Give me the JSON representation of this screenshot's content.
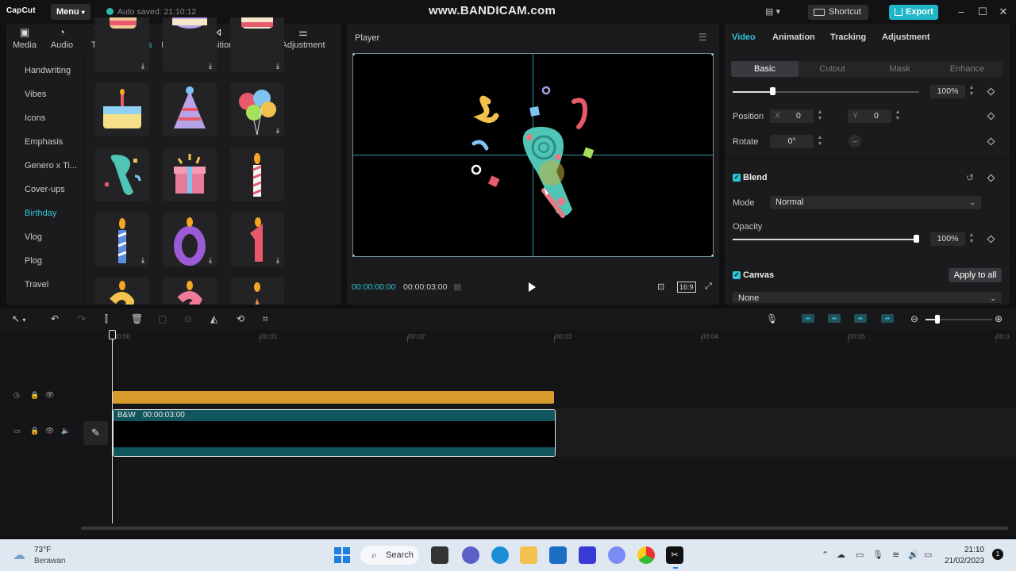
{
  "app": {
    "logo": "CapCut",
    "menu_label": "Menu",
    "autosave": "Auto saved: 21:10:12",
    "watermark": "www.BANDICAM.com",
    "shortcut_label": "Shortcut",
    "export_label": "Export",
    "accent_color": "#2ec3d6"
  },
  "media_tabs": [
    {
      "label": "Media",
      "icon": "media-icon"
    },
    {
      "label": "Audio",
      "icon": "audio-icon"
    },
    {
      "label": "Text",
      "icon": "text-icon"
    },
    {
      "label": "Stickers",
      "icon": "stickers-icon",
      "active": true
    },
    {
      "label": "Effects",
      "icon": "effects-icon"
    },
    {
      "label": "Transitions",
      "icon": "transitions-icon"
    },
    {
      "label": "Filters",
      "icon": "filters-icon"
    },
    {
      "label": "Adjustment",
      "icon": "adjustment-icon"
    }
  ],
  "sticker_categories": [
    {
      "label": "Handwriting"
    },
    {
      "label": "Vibes"
    },
    {
      "label": "Icons"
    },
    {
      "label": "Emphasis"
    },
    {
      "label": "Genero x Ti..."
    },
    {
      "label": "Cover-ups"
    },
    {
      "label": "Birthday",
      "active": true
    },
    {
      "label": "Vlog"
    },
    {
      "label": "Plog"
    },
    {
      "label": "Travel"
    }
  ],
  "stickers": [
    {
      "name": "cake-sticker-top-1",
      "download": true
    },
    {
      "name": "cake-sticker-top-2",
      "download": true
    },
    {
      "name": "cake-sticker-top-3",
      "download": true
    },
    {
      "name": "birthday-cake-sticker",
      "download": false
    },
    {
      "name": "party-hat-sticker",
      "download": false
    },
    {
      "name": "balloons-sticker",
      "download": true
    },
    {
      "name": "party-horn-sticker",
      "download": false
    },
    {
      "name": "gift-box-sticker",
      "download": false
    },
    {
      "name": "candle-sticker",
      "download": false
    },
    {
      "name": "blue-candle-sticker",
      "download": true
    },
    {
      "name": "number-0-candle-sticker",
      "download": true
    },
    {
      "name": "number-1-candle-sticker",
      "download": true
    },
    {
      "name": "number-2-candle-sticker",
      "download": false
    },
    {
      "name": "number-3-candle-sticker",
      "download": false
    },
    {
      "name": "orange-candle-sticker",
      "download": false
    }
  ],
  "player": {
    "label": "Player",
    "current_time": "00:00:00:00",
    "total_time": "00:00:03:00",
    "ratio_label": "16:9"
  },
  "inspector": {
    "tabs": [
      "Video",
      "Animation",
      "Tracking",
      "Adjustment"
    ],
    "subtabs": [
      "Basic",
      "Cutout",
      "Mask",
      "Enhance"
    ],
    "scale_value": "100%",
    "scale_fraction": 1.0,
    "position_label": "Position",
    "pos_x_label": "X",
    "pos_x": "0",
    "pos_y_label": "Y",
    "pos_y": "0",
    "rotate_label": "Rotate",
    "rotate_value": "0°",
    "blend_label": "Blend",
    "mode_label": "Mode",
    "mode_value": "Normal",
    "opacity_label": "Opacity",
    "opacity_value": "100%",
    "opacity_fraction": 1.0,
    "canvas_label": "Canvas",
    "apply_all_label": "Apply to all",
    "canvas_value": "None"
  },
  "timeline": {
    "ruler": [
      "00:00",
      "00:01",
      "00:02",
      "00:03",
      "00:04",
      "00:05",
      "00:0"
    ],
    "video_clip_name": "B&W",
    "video_clip_duration": "00:00:03:00",
    "sticker_clip_color": "#d79c2c",
    "video_clip_color": "#11565d"
  },
  "taskbar": {
    "temperature": "73°F",
    "weather": "Berawan",
    "search_label": "Search",
    "time": "21:10",
    "date": "21/02/2023",
    "notifications": "1"
  }
}
